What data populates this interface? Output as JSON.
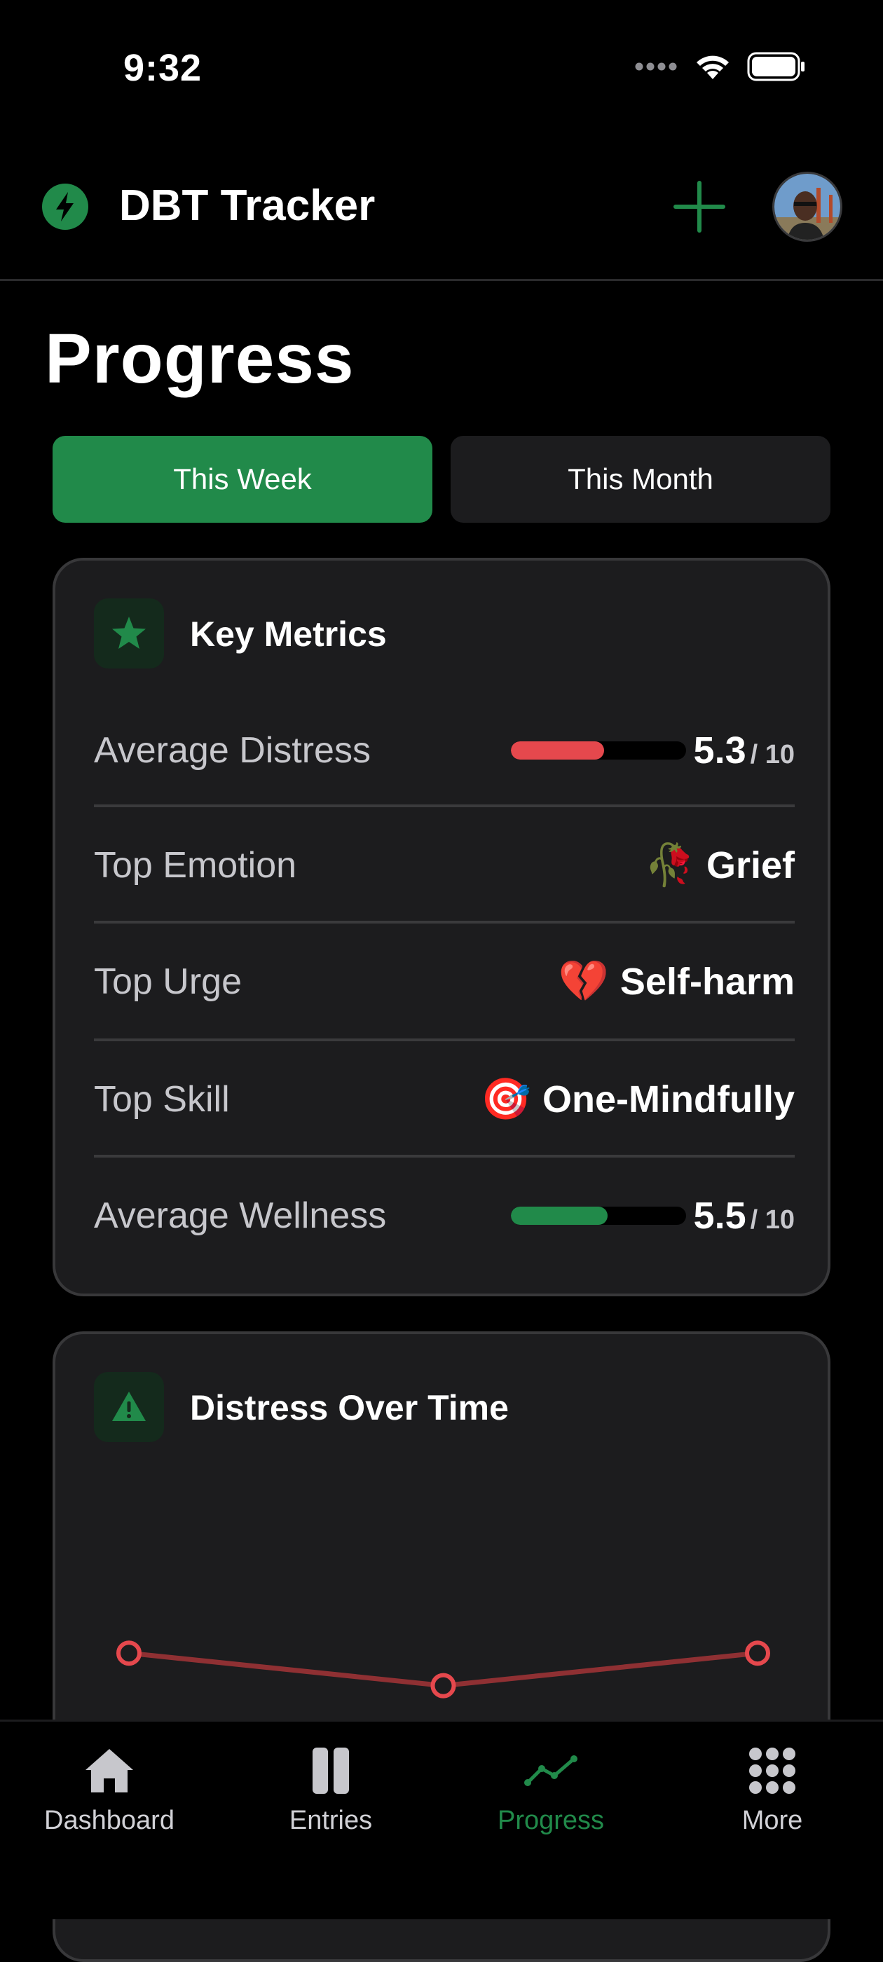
{
  "status_bar": {
    "time": "9:32"
  },
  "header": {
    "app_title": "DBT Tracker"
  },
  "page": {
    "title": "Progress"
  },
  "segments": {
    "week": "This Week",
    "month": "This Month",
    "selected": "This Week"
  },
  "metrics": {
    "title": "Key Metrics",
    "average_distress": {
      "label": "Average Distress",
      "value": "5.3",
      "max": "/ 10",
      "fraction": 0.53
    },
    "top_emotion": {
      "label": "Top Emotion",
      "emoji": "🥀",
      "value": "Grief"
    },
    "top_urge": {
      "label": "Top Urge",
      "emoji": "💔",
      "value": "Self-harm"
    },
    "top_skill": {
      "label": "Top Skill",
      "emoji": "🎯",
      "value": "One-Mindfully"
    },
    "average_wellness": {
      "label": "Average Wellness",
      "value": "5.5",
      "max": "/ 10",
      "fraction": 0.55
    }
  },
  "distress_chart": {
    "title": "Distress Over Time"
  },
  "chart_data": {
    "type": "line",
    "title": "Distress Over Time",
    "series": [
      {
        "values": [
          5.6,
          4.8,
          5.6
        ]
      }
    ],
    "color": "#e5484d"
  },
  "tab_bar": {
    "items": [
      {
        "label": "Dashboard",
        "icon": "house-icon"
      },
      {
        "label": "Entries",
        "icon": "book-icon"
      },
      {
        "label": "Progress",
        "icon": "chart-line-icon"
      },
      {
        "label": "More",
        "icon": "grid-icon"
      }
    ],
    "active": "Progress"
  },
  "colors": {
    "accent": "#218a4a",
    "distress": "#e5484d",
    "card": "#1c1c1e"
  }
}
